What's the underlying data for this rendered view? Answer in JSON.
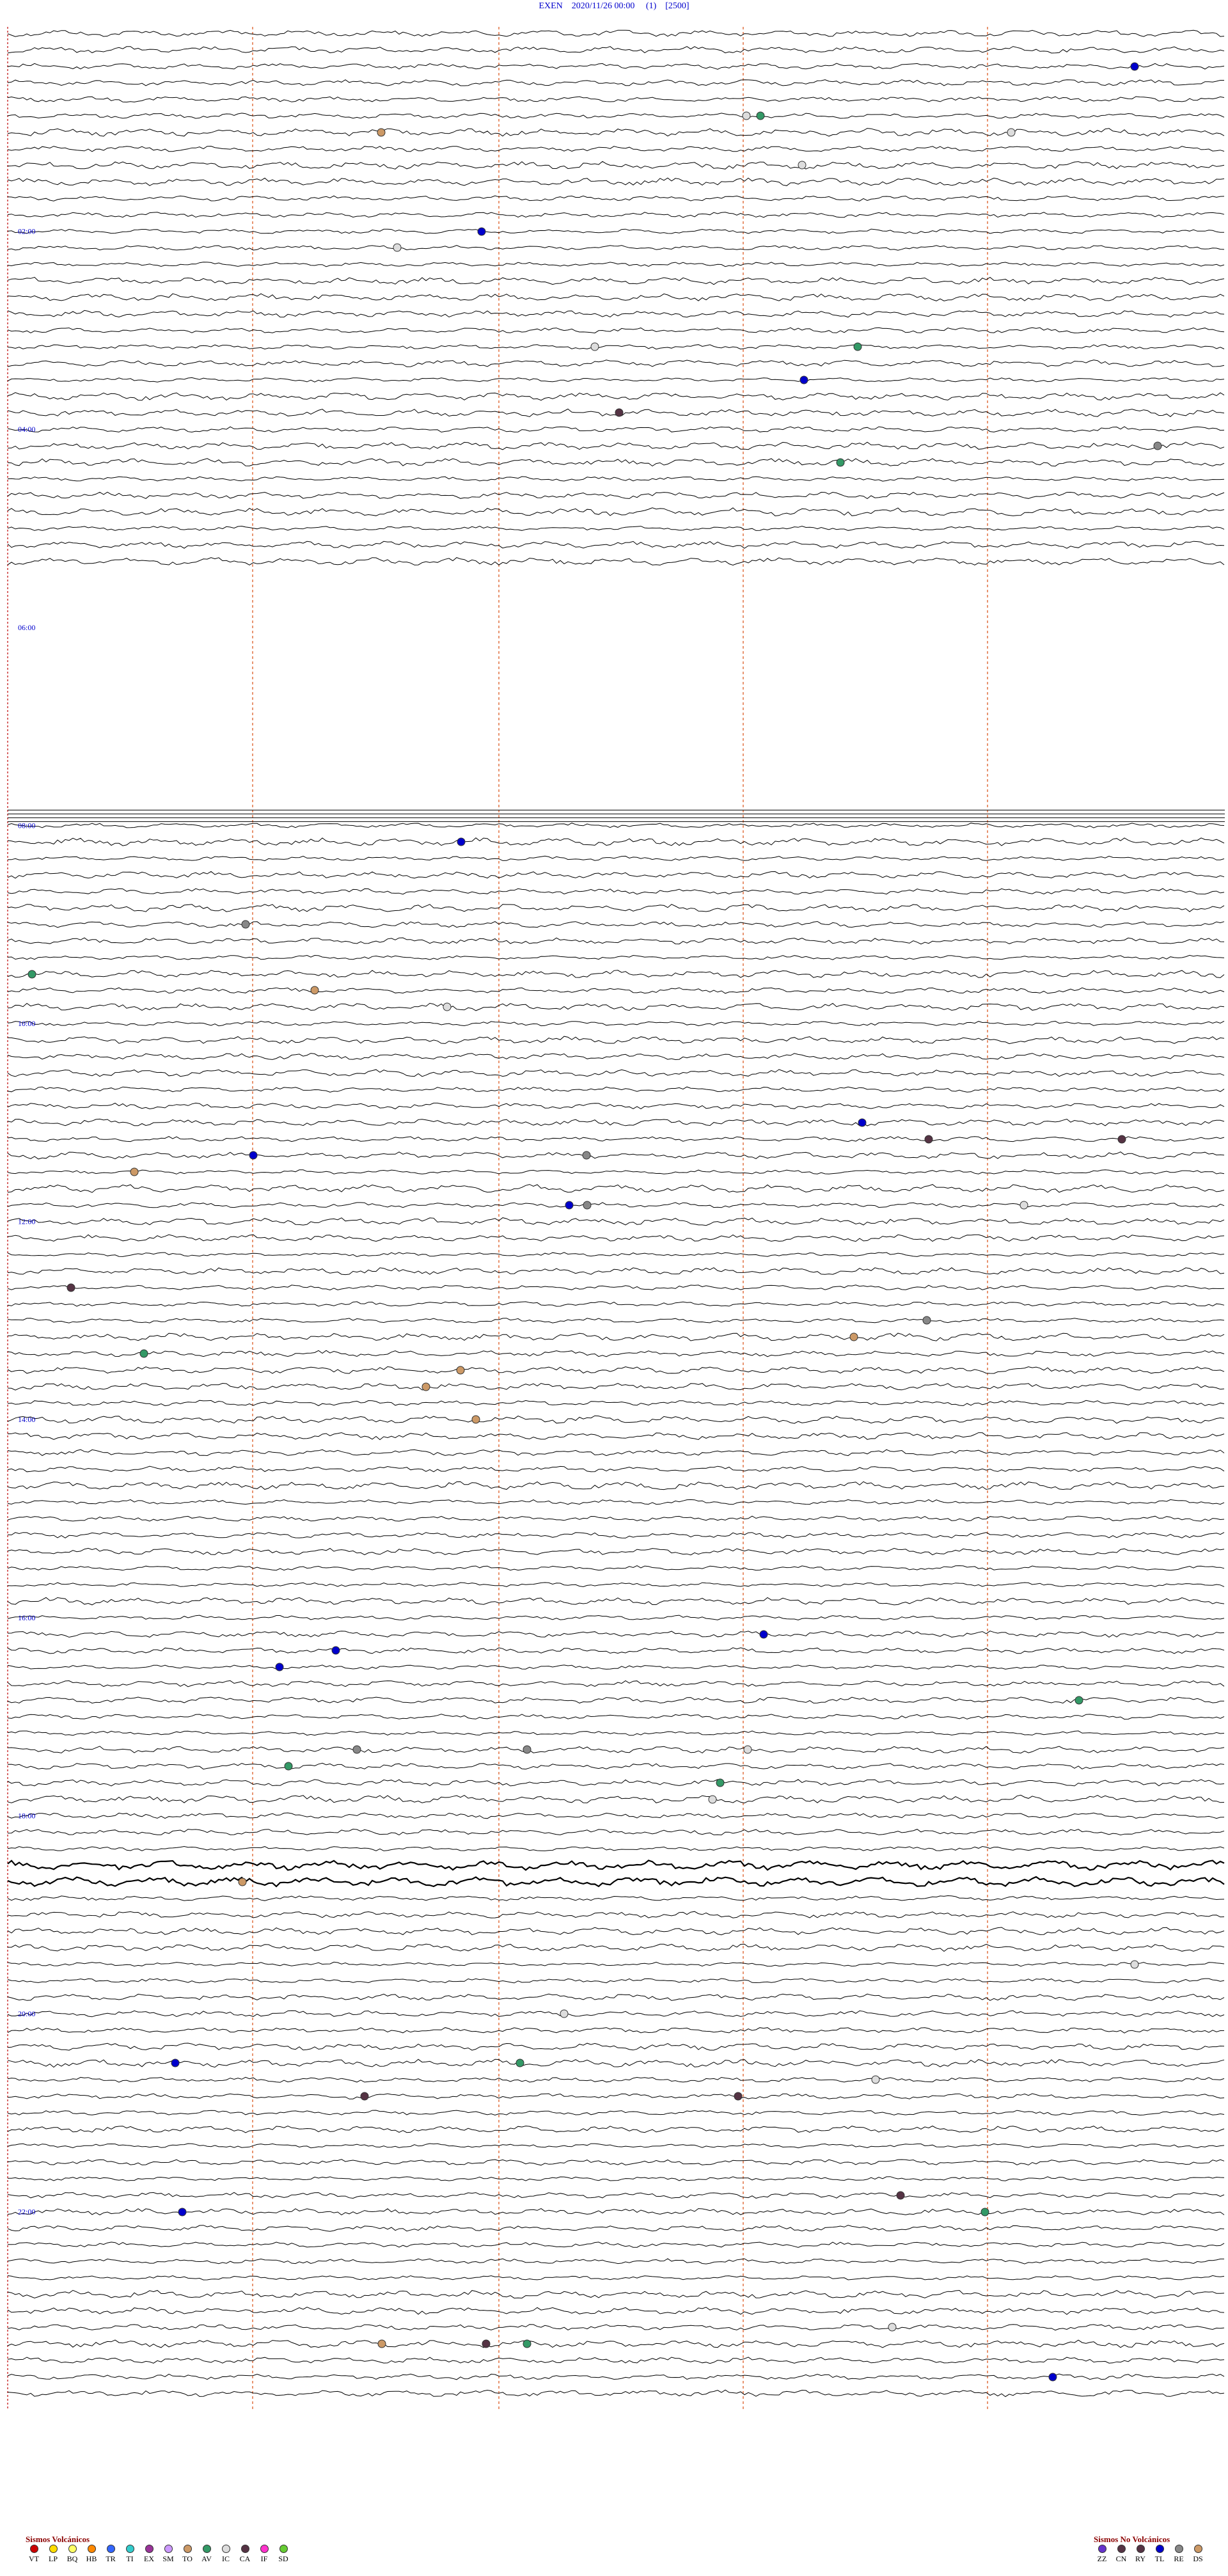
{
  "header": {
    "station": "EXEN",
    "date": "2020/11/26 00:00",
    "channel": "(1)",
    "scale": "[2500]"
  },
  "chart_data": {
    "type": "line",
    "title": "EXEN    2020/11/26 00:00     (1)    [2500]",
    "hour_labels": [
      "02:00",
      "04:00",
      "06:00",
      "08:00",
      "10:00",
      "12:00",
      "14:00",
      "16:00",
      "18:00",
      "20:00",
      "22:00"
    ],
    "gap": {
      "from": "05:30",
      "to": "08:00"
    },
    "colors": {
      "trace": "#000000",
      "minute_grid": "#e07040",
      "label": "#0000cc"
    }
  },
  "legend": {
    "volcanic": {
      "title": "Sismos Volcánicos",
      "items": [
        {
          "code": "VT",
          "color": "#cc0000"
        },
        {
          "code": "LP",
          "color": "#ffdd00"
        },
        {
          "code": "BQ",
          "color": "#ffff66"
        },
        {
          "code": "HB",
          "color": "#ff8800"
        },
        {
          "code": "TR",
          "color": "#3366ff"
        },
        {
          "code": "TI",
          "color": "#33cccc"
        },
        {
          "code": "EX",
          "color": "#993399"
        },
        {
          "code": "SM",
          "color": "#cc99ff"
        },
        {
          "code": "TO",
          "color": "#cc9966"
        },
        {
          "code": "AV",
          "color": "#339966"
        },
        {
          "code": "IC",
          "color": "#dddddd"
        },
        {
          "code": "CA",
          "color": "#553344"
        },
        {
          "code": "IF",
          "color": "#ff33cc"
        },
        {
          "code": "SD",
          "color": "#66cc33"
        }
      ]
    },
    "non_volcanic": {
      "title": "Sismos No Volcánicos",
      "items": [
        {
          "code": "ZZ",
          "color": "#6633cc"
        },
        {
          "code": "CN",
          "color": "#553344"
        },
        {
          "code": "RY",
          "color": "#553344"
        },
        {
          "code": "TL",
          "color": "#0000cc"
        },
        {
          "code": "RE",
          "color": "#888888"
        },
        {
          "code": "DS",
          "color": "#cc9966"
        }
      ]
    }
  }
}
